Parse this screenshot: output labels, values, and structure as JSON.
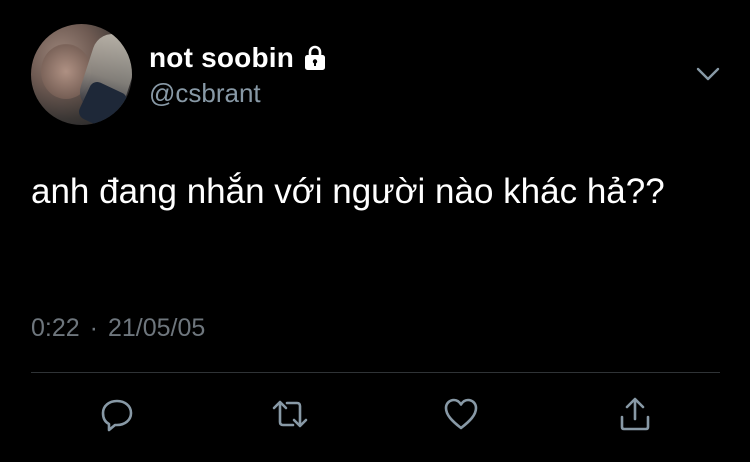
{
  "tweet": {
    "display_name": "not soobin",
    "handle": "@csbrant",
    "text": "anh đang nhắn với người nào khác hả??",
    "time": "0:22",
    "separator": "·",
    "date": "21/05/05"
  },
  "icons": {
    "protected": "lock-icon",
    "menu": "chevron-down-icon",
    "reply": "reply-icon",
    "retweet": "retweet-icon",
    "like": "heart-icon",
    "share": "share-icon"
  },
  "colors": {
    "background": "#000000",
    "text_primary": "#ffffff",
    "text_secondary": "#8899a6",
    "icon": "#8899a6",
    "divider": "#2f3336"
  }
}
